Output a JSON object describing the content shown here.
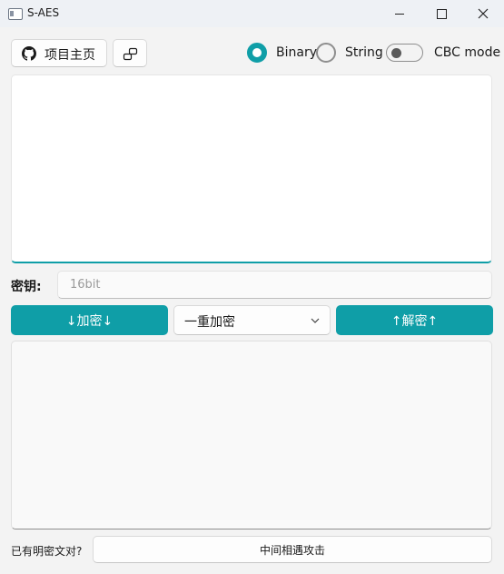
{
  "window": {
    "title": "S-AES",
    "controls": [
      "minimize-icon",
      "maximize-icon",
      "close-icon"
    ]
  },
  "toolbar": {
    "home_label": "项目主页",
    "home_icon": "github-icon",
    "link_icon": "link-icon",
    "mode_options": [
      {
        "label": "Binary",
        "selected": true
      },
      {
        "label": "String",
        "selected": false
      }
    ],
    "cbc": {
      "label": "CBC mode",
      "on": false
    }
  },
  "input": {
    "value": ""
  },
  "key": {
    "label": "密钥:",
    "placeholder": "16bit",
    "value": ""
  },
  "actions": {
    "encrypt_label": "↓加密↓",
    "decrypt_label": "↑解密↑",
    "mode_select": {
      "value": "一重加密"
    }
  },
  "output": {
    "value": ""
  },
  "attack": {
    "question_label": "已有明密文对?",
    "button_label": "中间相遇攻击"
  },
  "colors": {
    "accent": "#0f9ea7",
    "background": "#f3f3f3",
    "titlebar": "#eef1f5"
  }
}
